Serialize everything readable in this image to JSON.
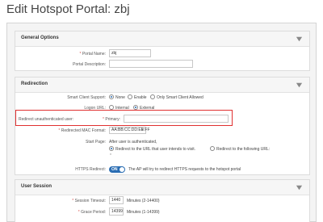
{
  "page": {
    "title": "Edit Hotspot Portal: zbj"
  },
  "general": {
    "title": "General Options",
    "portal_name_label": "Portal Name:",
    "portal_name_value": "zbj",
    "portal_desc_label": "Portal Description:",
    "portal_desc_value": ""
  },
  "redirection": {
    "title": "Redirection",
    "smart_client_label": "Smart Client Support:",
    "smart_client_options": [
      "None",
      "Enable",
      "Only Smart Client Allowed"
    ],
    "logon_url_label": "Logon URL:",
    "logon_url_options": [
      "Internal",
      "External"
    ],
    "redirect_unauth_label": "Redirect unauthenticated user:",
    "primary_label": "Primary:",
    "primary_value": "",
    "mac_format_label": "Redirected MAC Format:",
    "mac_format_value": "AA:BB:CC:DD:EE:FF",
    "start_page_label": "Start Page:",
    "start_page_intro": "After user is authenticated,",
    "start_page_option1": "Redirect to the URL that user intends to visit.",
    "start_page_option2": "Redirect to the following URL:",
    "start_page_url_value": "*",
    "https_redirect_label": "HTTPS Redirect:",
    "https_toggle_label": "ON",
    "https_redirect_note": "The AP will try to redirect HTTPS requests to the hotspot portal"
  },
  "user_session": {
    "title": "User Session",
    "session_timeout_label": "Session Timeout:",
    "session_timeout_value": "1440",
    "session_timeout_unit": "Minutes (2-14400)",
    "grace_period_label": "Grace Period:",
    "grace_period_value": "14399",
    "grace_period_unit": "Minutes (1-14399)"
  },
  "colors": {
    "accent": "#2a6db3",
    "highlight": "#e03030",
    "required": "#d9534f"
  }
}
